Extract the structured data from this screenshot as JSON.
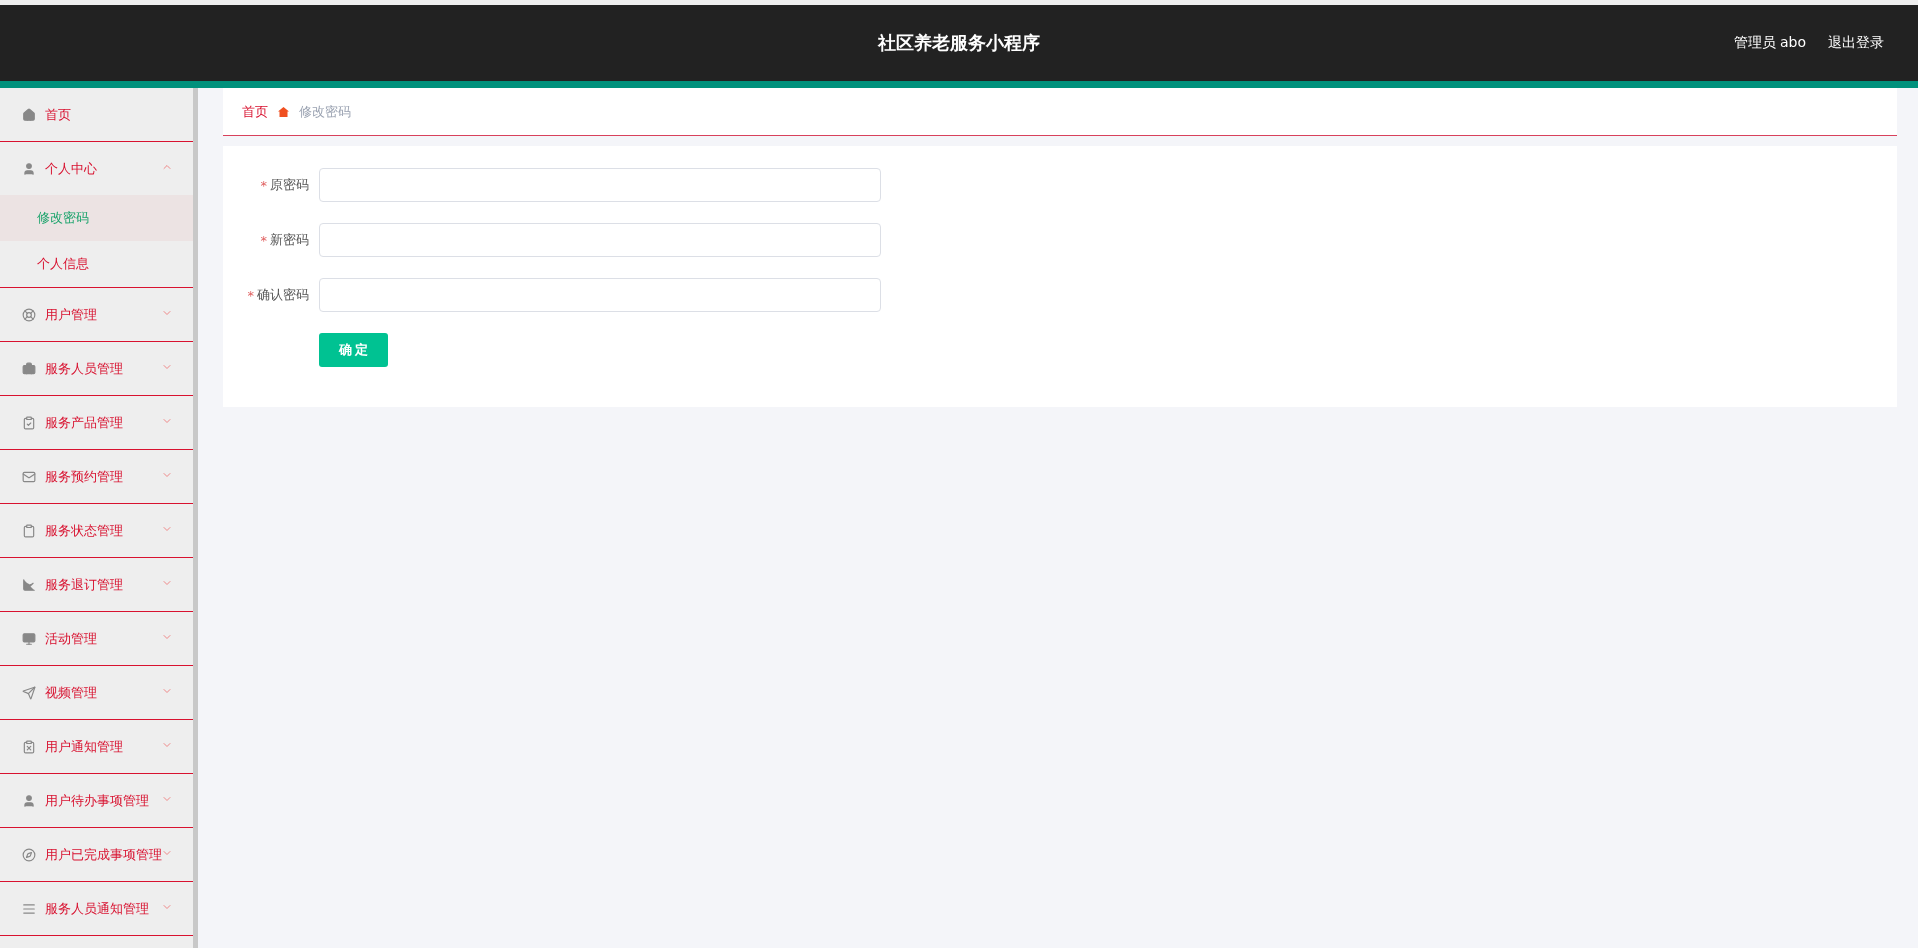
{
  "header": {
    "title": "社区养老服务小程序",
    "user": "管理员 abo",
    "logout": "退出登录"
  },
  "sidebar": {
    "items": [
      {
        "kind": "link",
        "label": "首页"
      },
      {
        "kind": "group",
        "label": "个人中心",
        "expanded": true,
        "children": [
          {
            "label": "修改密码",
            "selected": true
          },
          {
            "label": "个人信息",
            "selected": false
          }
        ]
      },
      {
        "kind": "group",
        "label": "用户管理",
        "expanded": false
      },
      {
        "kind": "group",
        "label": "服务人员管理",
        "expanded": false
      },
      {
        "kind": "group",
        "label": "服务产品管理",
        "expanded": false
      },
      {
        "kind": "group",
        "label": "服务预约管理",
        "expanded": false
      },
      {
        "kind": "group",
        "label": "服务状态管理",
        "expanded": false
      },
      {
        "kind": "group",
        "label": "服务退订管理",
        "expanded": false
      },
      {
        "kind": "group",
        "label": "活动管理",
        "expanded": false
      },
      {
        "kind": "group",
        "label": "视频管理",
        "expanded": false
      },
      {
        "kind": "group",
        "label": "用户通知管理",
        "expanded": false
      },
      {
        "kind": "group",
        "label": "用户待办事项管理",
        "expanded": false
      },
      {
        "kind": "group",
        "label": "用户已完成事项管理",
        "expanded": false
      },
      {
        "kind": "group",
        "label": "服务人员通知管理",
        "expanded": false
      }
    ]
  },
  "breadcrumb": [
    "首页",
    "修改密码"
  ],
  "form": {
    "fields": [
      {
        "mark": "*",
        "label": "原密码"
      },
      {
        "mark": "*",
        "label": "新密码"
      },
      {
        "mark": "*",
        "label": "确认密码"
      }
    ],
    "submit": "确 定"
  }
}
